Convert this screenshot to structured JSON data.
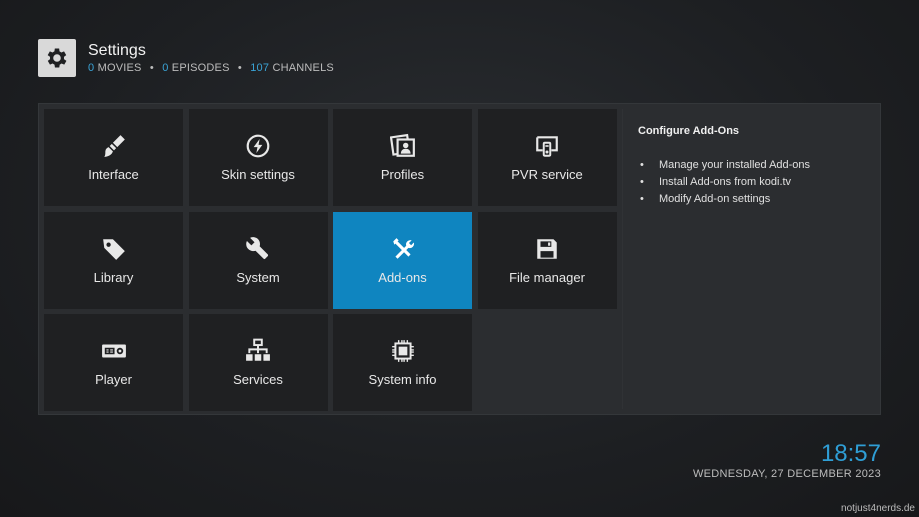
{
  "header": {
    "title": "Settings",
    "stats": [
      {
        "value": "0",
        "label": "MOVIES"
      },
      {
        "value": "0",
        "label": "EPISODES"
      },
      {
        "value": "107",
        "label": "CHANNELS"
      }
    ],
    "separator": "•"
  },
  "tiles": [
    {
      "label": "Interface",
      "icon": "paintbrush-icon"
    },
    {
      "label": "Skin settings",
      "icon": "lightning-circle-icon"
    },
    {
      "label": "Profiles",
      "icon": "profile-frames-icon"
    },
    {
      "label": "PVR service",
      "icon": "pvr-tv-icon"
    },
    {
      "label": "Library",
      "icon": "tag-icon"
    },
    {
      "label": "System",
      "icon": "wrench-icon"
    },
    {
      "label": "Add-ons",
      "icon": "hammer-wrench-icon",
      "focused": true
    },
    {
      "label": "File manager",
      "icon": "floppy-disk-icon"
    },
    {
      "label": "Player",
      "icon": "media-player-icon"
    },
    {
      "label": "Services",
      "icon": "network-tree-icon"
    },
    {
      "label": "System info",
      "icon": "cpu-chip-icon"
    }
  ],
  "info": {
    "title": "Configure Add-Ons",
    "items": [
      "Manage your installed Add-ons",
      "Install Add-ons from kodi.tv",
      "Modify Add-on settings"
    ]
  },
  "clock": {
    "time": "18:57",
    "date": "WEDNESDAY, 27 DECEMBER 2023"
  },
  "watermark": "notjust4nerds.de",
  "colors": {
    "accent": "#0f85c0",
    "highlight_text": "#3aa3d6",
    "tile_bg": "#1f2022",
    "panel_bg": "#2b2d30"
  }
}
